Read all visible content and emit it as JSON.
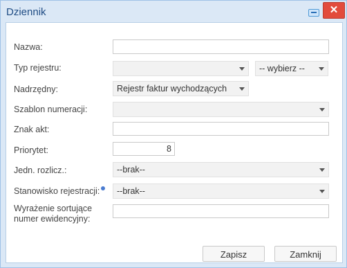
{
  "window": {
    "title": "Dziennik"
  },
  "form": {
    "nazwa_label": "Nazwa:",
    "typ_label": "Typ rejestru:",
    "typ_extra": "-- wybierz --",
    "nadrzedny_label": "Nadrzędny:",
    "nadrzedny_value": "Rejestr faktur wychodzących",
    "szablon_label": "Szablon numeracji:",
    "znak_label": "Znak akt:",
    "priorytet_label": "Priorytet:",
    "priorytet_value": "8",
    "jedn_label": "Jedn. rozlicz.:",
    "jedn_value": "--brak--",
    "stanowisko_label": "Stanowisko rejestracji:",
    "stanowisko_value": "--brak--",
    "wyrazenie_label_1": "Wyrażenie sortujące",
    "wyrazenie_label_2": "numer ewidencyjny:"
  },
  "buttons": {
    "save": "Zapisz",
    "close": "Zamknij"
  },
  "icons": {
    "close": "close-icon",
    "minimize": "minimize-icon",
    "info": "info-icon"
  }
}
